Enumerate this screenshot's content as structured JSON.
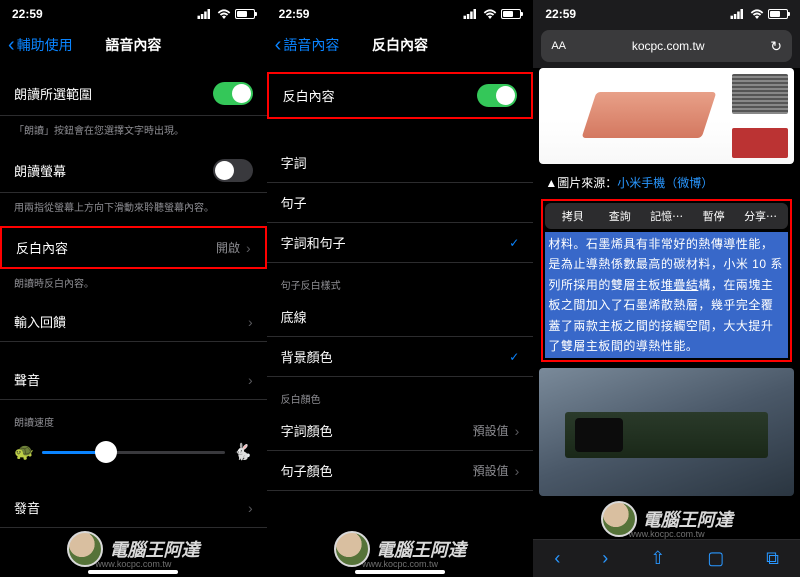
{
  "status": {
    "time": "22:59"
  },
  "phone1": {
    "back": "輔助使用",
    "title": "語音內容",
    "row_speak_selection": "朗讀所選範圍",
    "footer_speak_selection": "「朗讀」按鈕會在您選擇文字時出現。",
    "row_speak_screen": "朗讀螢幕",
    "footer_speak_screen": "用兩指從螢幕上方向下滑動來聆聽螢幕內容。",
    "row_highlight": "反白內容",
    "row_highlight_value": "開啟",
    "footer_highlight": "朗讀時反白內容。",
    "row_typing_feedback": "輸入回饋",
    "row_voice": "聲音",
    "section_rate": "朗讀速度",
    "row_pronunciation": "發音"
  },
  "phone2": {
    "back": "語音內容",
    "title": "反白內容",
    "row_highlight": "反白內容",
    "row_words": "字詞",
    "row_sentences": "句子",
    "row_words_sentences": "字詞和句子",
    "section_sentence_style": "句子反白樣式",
    "row_underline": "底線",
    "row_bgcolor": "背景顏色",
    "section_highlight_color": "反白顏色",
    "row_word_color": "字詞顏色",
    "row_sentence_color": "句子顏色",
    "default_value": "預設值"
  },
  "phone3": {
    "url": "kocpc.com.tw",
    "caption_prefix": "▲圖片來源：",
    "caption_link": "小米手機（微博）",
    "menu": {
      "copy": "拷貝",
      "lookup": "查詢",
      "remember": "記憶⋯",
      "pause": "暫停",
      "share": "分享⋯"
    },
    "selected_text_prefix": "材料。",
    "selected_text_main": "石墨烯具有非常好的熱傳導性能，是為止導熱係數最高的碳材料，小米 10 系列所採用的雙層主板",
    "selected_text_link": "堆疊結",
    "selected_text_suffix": "構，在兩塊主板之間加入了石墨烯散熱層，幾乎完全覆蓋了兩款主板之間的接觸空間，大大提升了雙層主板間的導熱性能。"
  },
  "watermark": {
    "text": "電腦王阿達",
    "sub": "www.kocpc.com.tw"
  }
}
